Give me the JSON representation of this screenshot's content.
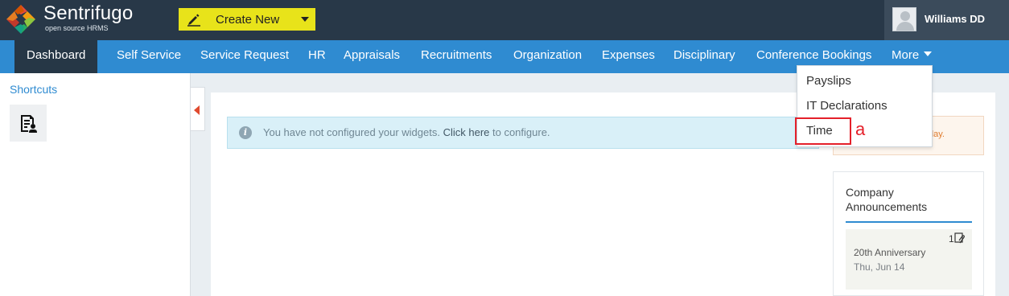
{
  "brand": {
    "name": "Sentrifugo",
    "tagline": "open source HRMS"
  },
  "header": {
    "create_label": "Create New",
    "user_name": "Williams DD"
  },
  "nav": {
    "items": [
      {
        "label": "Dashboard"
      },
      {
        "label": "Self Service"
      },
      {
        "label": "Service Request"
      },
      {
        "label": "HR"
      },
      {
        "label": "Appraisals"
      },
      {
        "label": "Recruitments"
      },
      {
        "label": "Organization"
      },
      {
        "label": "Expenses"
      },
      {
        "label": "Disciplinary"
      },
      {
        "label": "Conference Bookings"
      },
      {
        "label": "More"
      }
    ]
  },
  "more_menu": {
    "items": [
      "Payslips",
      "IT Declarations",
      "Time"
    ]
  },
  "annotation_mark": "a",
  "sidebar": {
    "shortcuts_label": "Shortcuts"
  },
  "info": {
    "text_before": "You have not configured your widgets.",
    "link": "Click here",
    "text_after": "to configure."
  },
  "alert_box": {
    "text": "day."
  },
  "announcements": {
    "title": "Company Announcements",
    "item": {
      "count": "1",
      "name": "20th Anniversary",
      "date": "Thu, Jun 14"
    }
  },
  "colors": {
    "topbar": "#283848",
    "nav": "#2f8bd1",
    "accent_yellow": "#e8e31a",
    "highlight_red": "#e4202a"
  }
}
